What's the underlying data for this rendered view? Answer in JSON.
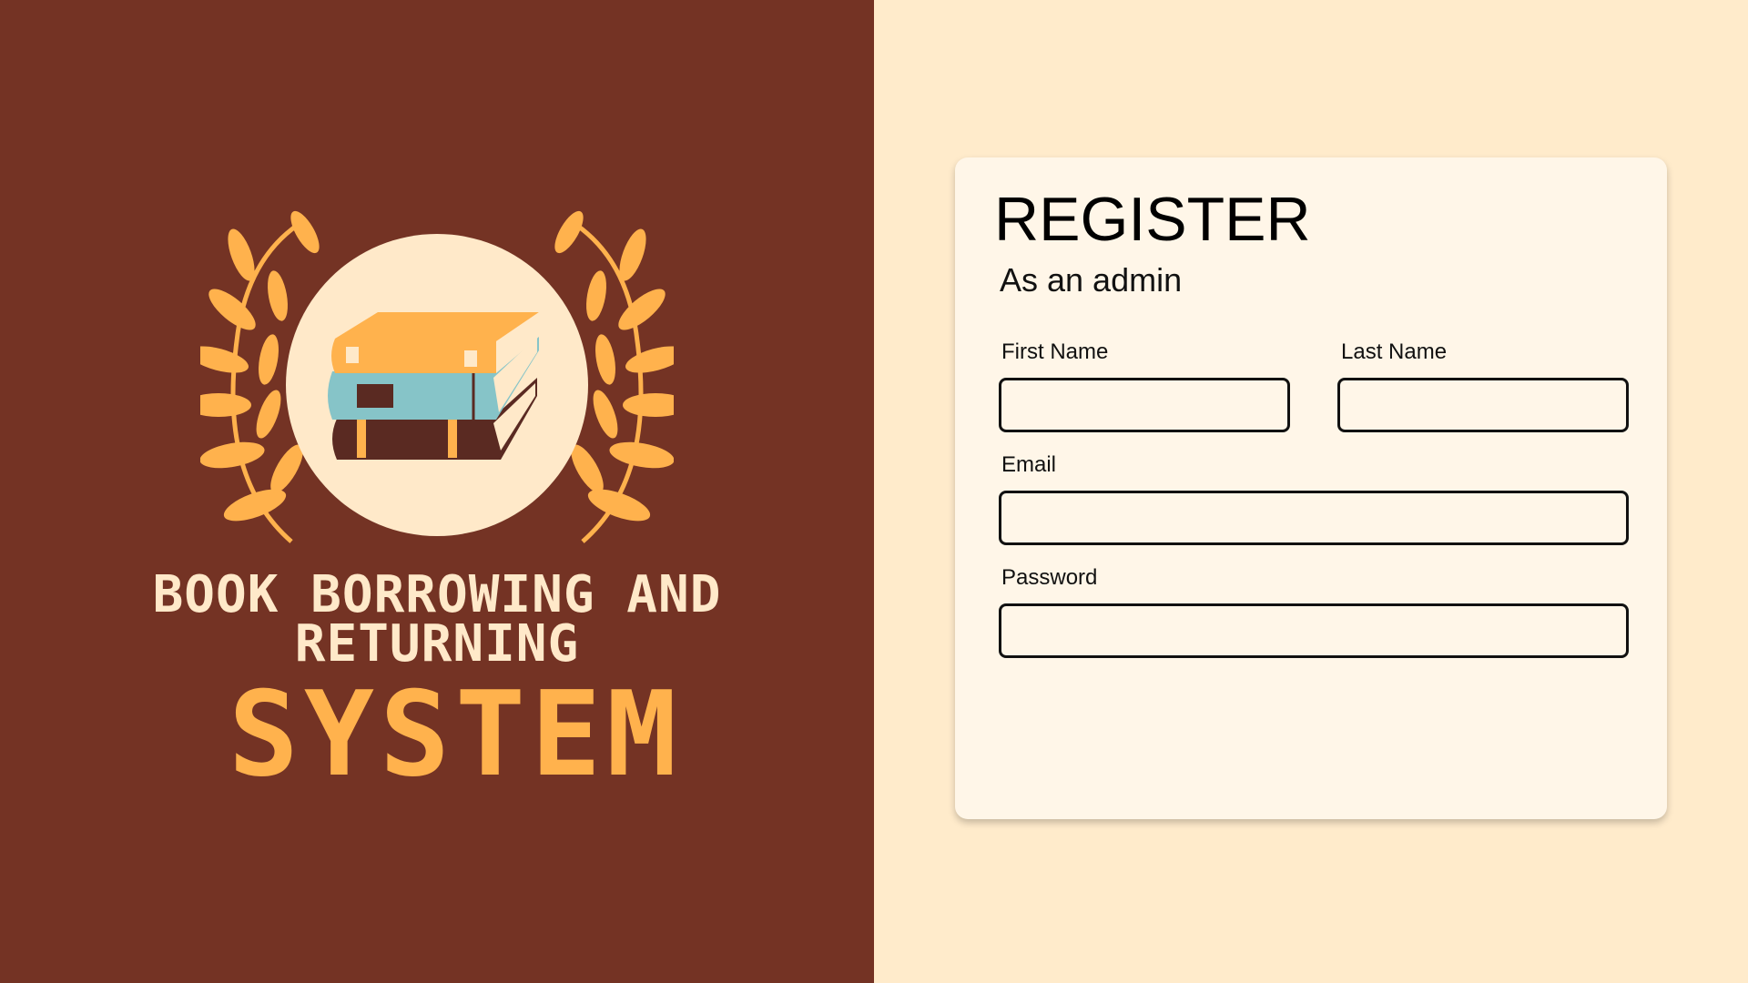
{
  "brand": {
    "line1": "BOOK BORROWING AND",
    "line2": "RETURNING",
    "line3": "SYSTEM",
    "emblem_icon": "books-stack-laurel-icon"
  },
  "form": {
    "title": "REGISTER",
    "subtitle": "As an admin",
    "fields": {
      "first_name": {
        "label": "First Name",
        "value": "",
        "placeholder": ""
      },
      "last_name": {
        "label": "Last Name",
        "value": "",
        "placeholder": ""
      },
      "email": {
        "label": "Email",
        "value": "",
        "placeholder": ""
      },
      "password": {
        "label": "Password",
        "value": "",
        "placeholder": ""
      }
    }
  },
  "colors": {
    "brand_panel": "#743324",
    "page_background": "#FFEBCB",
    "card_background": "#FFF6E8",
    "accent_orange": "#FFB24D",
    "emblem_circle": "#FFE9C9",
    "book_blue": "#86C4C8"
  }
}
